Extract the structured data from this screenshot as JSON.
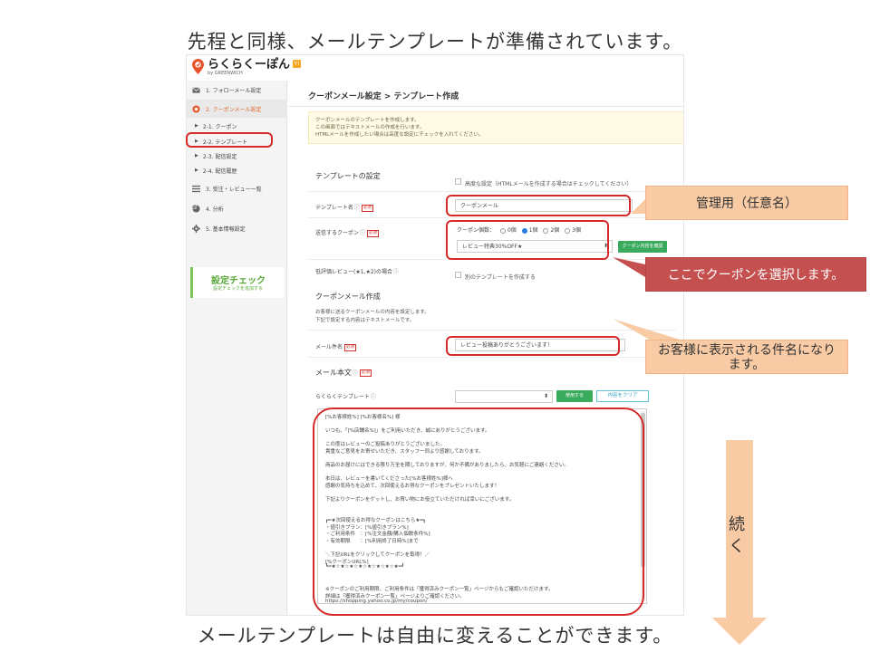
{
  "slide": {
    "title": "先程と同様、メールテンプレートが準備されています。",
    "footer": "メールテンプレートは自由に変えることができます。",
    "continue_label": "続く"
  },
  "app": {
    "logo_name": "らくらくーぽん",
    "logo_sub": "by GREENWICH",
    "logo_badge": "Y!"
  },
  "sidebar": {
    "items": [
      {
        "label": "1. フォローメール設定",
        "icon": "mail-icon"
      },
      {
        "label": "2. クーポンメール設定",
        "icon": "coupon-icon"
      },
      {
        "label": "3. 受注・レビュー一覧",
        "icon": "list-icon"
      },
      {
        "label": "4. 分析",
        "icon": "pie-chart-icon"
      },
      {
        "label": "5. 基本情報設定",
        "icon": "gear-icon"
      }
    ],
    "sub_items": [
      {
        "label": "2-1. クーポン"
      },
      {
        "label": "2-2. テンプレート"
      },
      {
        "label": "2-3. 配信設定"
      },
      {
        "label": "2-4. 配信履歴"
      }
    ],
    "check_title": "設定チェック",
    "check_sub": "設定チェックを追加する"
  },
  "main": {
    "breadcrumb": "クーポンメール設定 > テンプレート作成",
    "notice": [
      "クーポンメールのテンプレートを作成します。",
      "この画面ではテキストメールの作成を行います。",
      "HTMLメールを作成したい場合は高度な設定にチェックを入れてください。"
    ],
    "template_settings_heading": "テンプレートの設定",
    "advanced_label": "高度な設定（HTMLメールを作成する場合はチェックしてください）",
    "template_name_label": "テンプレート名",
    "template_name_value": "クーポンメール",
    "coupon_label": "送信するクーポン",
    "coupon_count_label": "クーポン個数：",
    "coupon_count_options": [
      "0個",
      "1個",
      "2個",
      "3個"
    ],
    "coupon_count_selected": "1個",
    "coupon_select_value": "レビュー特典30%OFF★",
    "coupon_confirm_button": "クーポン内容を確認",
    "low_rating_label": "低評価レビュー(★1,★2)の場合",
    "low_rating_check_label": "別のテンプレートを作成する",
    "coupon_mail_heading": "クーポンメール作成",
    "coupon_mail_desc": [
      "お客様に送るクーポンメールの内容を設定します。",
      "下記で設定する内容はテキストメールです。"
    ],
    "subject_label": "メール件名",
    "subject_value": "レビュー投稿ありがとうございます！",
    "body_heading": "メール本文",
    "rakuraku_template_label": "らくらくテンプレート",
    "use_button": "使用する",
    "clear_button": "内容をクリア",
    "required_badge": "必須",
    "body_lines": [
      "[%お客様姓%] [%お客様名%] 様",
      "",
      "いつも、「[%店舗名%]」をご利用いただき、誠にありがとうございます。",
      "",
      "この度はレビューのご投稿ありがとうございました。",
      "貴重なご意見をお寄せいただき、スタッフ一同より感謝しております。",
      "",
      "商品のお届けにはできる限り万全を期しておりますが、何か不備がありましたら、お気軽にご連絡ください。",
      "",
      "本日は、レビューを書いてくださった[%お客様姓%]様へ",
      "感謝の気持ちを込めて、次回使えるお得なクーポンをプレゼントいたします！",
      "",
      "下記よりクーポンをゲットし、お買い物にお役立ていただければ幸いにございます。",
      "",
      "",
      "┏━★次回使えるお得なクーポンはこちら★━┓",
      "・値引きプラン：[%値引きプラン%]",
      "・ご利用条件　：[%注文金額/購入個数条件%]",
      "・有効期限　　：[%利用終了日時%]まで",
      "",
      "＼下記URLをクリックしてクーポンを取得！／",
      "[%クーポンURL%]",
      "┗━★☆★☆★☆★☆★☆★☆★☆★━┛",
      "",
      "",
      "※クーポンのご利用期限、ご利用条件は「獲得済みクーポン一覧」ページからもご確認いただけます。",
      "詳細は「獲得済みクーポン一覧」ページよりご確認ください。",
      "https://shopping.yahoo.co.jp/my/coupon/"
    ]
  },
  "callouts": {
    "admin": "管理用（任意名）",
    "coupon_select": "ここでクーポンを選択します。",
    "subject": "お客様に表示される件名になります。"
  },
  "colors": {
    "highlight": "#d42a2a",
    "callout_orange": "#f8cba5",
    "callout_red": "#c55050",
    "accent_green": "#3aaa5c",
    "sidebar_active": "#e06a2c"
  }
}
